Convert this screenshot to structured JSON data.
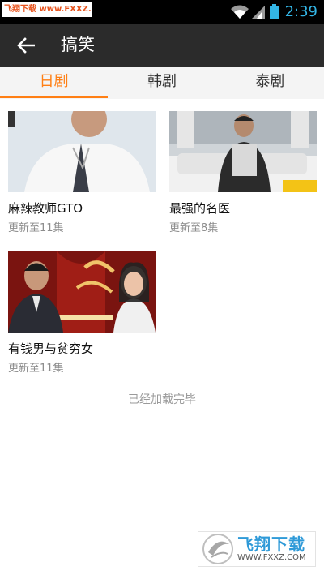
{
  "status_bar": {
    "watermark": "飞翔下载 www.FXXZ.com",
    "time": "2:39",
    "accent": "#33b5e5"
  },
  "action_bar": {
    "back_icon": "arrow-back-icon",
    "title": "搞笑"
  },
  "tabs": [
    {
      "label": "日剧",
      "active": true
    },
    {
      "label": "韩剧",
      "active": false
    },
    {
      "label": "泰剧",
      "active": false
    }
  ],
  "accent_color": "#ff7f14",
  "shows": [
    {
      "title": "麻辣教师GTO",
      "update": "更新至11集"
    },
    {
      "title": "最强的名医",
      "update": "更新至8集"
    },
    {
      "title": "有钱男与贫穷女",
      "update": "更新至11集"
    }
  ],
  "footer": {
    "load_complete": "已经加载完毕"
  },
  "bottom_watermark": {
    "name": "飞翔下载",
    "url": "WWW.FXXZ.COM"
  }
}
